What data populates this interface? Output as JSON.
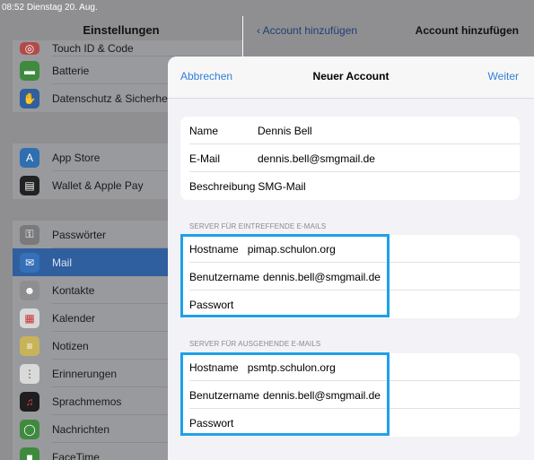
{
  "status_bar": {
    "time": "08:52",
    "date": "Dienstag 20. Aug."
  },
  "sidebar": {
    "title": "Einstellungen",
    "group1": [
      {
        "label": "Touch ID & Code",
        "icon": "fingerprint-icon",
        "color": "#b34a4a"
      },
      {
        "label": "Batterie",
        "icon": "battery-icon",
        "color": "#3f8a3f"
      },
      {
        "label": "Datenschutz & Sicherheit",
        "icon": "hand-icon",
        "color": "#2f5f9e"
      }
    ],
    "group2": [
      {
        "label": "App Store",
        "icon": "appstore-icon",
        "color": "#2f6fb0"
      },
      {
        "label": "Wallet & Apple Pay",
        "icon": "wallet-icon",
        "color": "#222222"
      }
    ],
    "group3": [
      {
        "label": "Passwörter",
        "icon": "key-icon",
        "color": "#7a7a7d"
      },
      {
        "label": "Mail",
        "icon": "mail-icon",
        "color": "#3570b8",
        "selected": true
      },
      {
        "label": "Kontakte",
        "icon": "contacts-icon",
        "color": "#8e8e90"
      },
      {
        "label": "Kalender",
        "icon": "calendar-icon",
        "color": "#d8d8d8"
      },
      {
        "label": "Notizen",
        "icon": "notes-icon",
        "color": "#c9b35a"
      },
      {
        "label": "Erinnerungen",
        "icon": "reminders-icon",
        "color": "#d9d9d9"
      },
      {
        "label": "Sprachmemos",
        "icon": "voicememo-icon",
        "color": "#1e1e1e"
      },
      {
        "label": "Nachrichten",
        "icon": "messages-icon",
        "color": "#3f8a3f"
      },
      {
        "label": "FaceTime",
        "icon": "facetime-icon",
        "color": "#3f8a3f"
      }
    ]
  },
  "right_pane": {
    "back_label": "Account hinzufügen",
    "title": "Account hinzufügen"
  },
  "sheet": {
    "cancel_label": "Abbrechen",
    "title": "Neuer Account",
    "next_label": "Weiter",
    "account": {
      "name_label": "Name",
      "name_value": "Dennis Bell",
      "email_label": "E-Mail",
      "email_value": "dennis.bell@smgmail.de",
      "desc_label": "Beschreibung",
      "desc_value": "SMG-Mail"
    },
    "incoming": {
      "section_label": "SERVER FÜR EINTREFFENDE E-MAILS",
      "host_label": "Hostname",
      "host_value": "pimap.schulon.org",
      "user_label": "Benutzername",
      "user_value": "dennis.bell@smgmail.de",
      "pass_label": "Passwort"
    },
    "outgoing": {
      "section_label": "SERVER FÜR AUSGEHENDE E-MAILS",
      "host_label": "Hostname",
      "host_value": "psmtp.schulon.org",
      "user_label": "Benutzername",
      "user_value": "dennis.bell@smgmail.de",
      "pass_label": "Passwort"
    }
  },
  "colors": {
    "accent": "#2f7fd8",
    "highlight": "#1ea1e8",
    "dim": "#8f8f92"
  }
}
